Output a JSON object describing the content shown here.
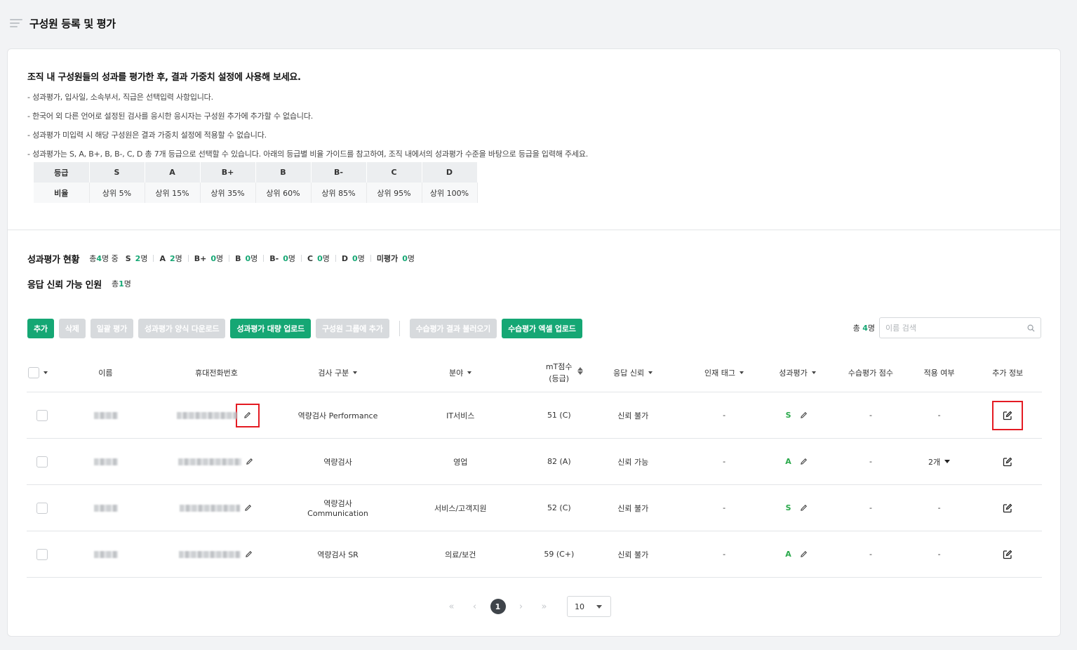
{
  "header": {
    "title": "구성원 등록 및 평가"
  },
  "info": {
    "title": "조직 내 구성원들의 성과를 평가한 후, 결과 가중치 설정에 사용해 보세요.",
    "notes": [
      "- 성과평가, 입사일, 소속부서, 직급은 선택입력 사항입니다.",
      "- 한국어 외 다른 언어로 설정된 검사를 응시한 응시자는 구성원 추가에 추가할 수 없습니다.",
      "- 성과평가 미입력 시 해당 구성원은 결과 가중치 설정에 적용할 수 없습니다.",
      "- 성과평가는 S, A, B+, B, B-, C, D 총 7개 등급으로 선택할 수 있습니다. 아래의 등급별 비율 가이드를 참고하여, 조직 내에서의 성과평가 수준을 바탕으로 등급을 입력해 주세요."
    ],
    "grade_table": {
      "head_label": "등급",
      "body_label": "비율",
      "grades": [
        "S",
        "A",
        "B+",
        "B",
        "B-",
        "C",
        "D"
      ],
      "ratios": [
        "상위 5%",
        "상위 15%",
        "상위 35%",
        "상위 60%",
        "상위 85%",
        "상위 95%",
        "상위 100%"
      ]
    }
  },
  "stats": {
    "eval_title": "성과평가 현황",
    "eval_total_prefix": "총 ",
    "eval_total_n": "4",
    "eval_total_suffix": "명 중",
    "items": [
      {
        "label": "S",
        "n": "2",
        "unit": "명"
      },
      {
        "label": "A",
        "n": "2",
        "unit": "명"
      },
      {
        "label": "B+",
        "n": "0",
        "unit": "명"
      },
      {
        "label": "B",
        "n": "0",
        "unit": "명"
      },
      {
        "label": "B-",
        "n": "0",
        "unit": "명"
      },
      {
        "label": "C",
        "n": "0",
        "unit": "명"
      },
      {
        "label": "D",
        "n": "0",
        "unit": "명"
      },
      {
        "label": "미평가",
        "n": "0",
        "unit": "명"
      }
    ],
    "reliable_title": "응답 신뢰 가능 인원",
    "reliable_prefix": "총 ",
    "reliable_n": "1",
    "reliable_unit": "명"
  },
  "toolbar": {
    "add": "추가",
    "delete": "삭제",
    "bulk_eval": "일괄 평가",
    "download_form": "성과평가 양식 다운로드",
    "bulk_upload": "성과평가 대량 업로드",
    "add_to_group": "구성원 그룹에 추가",
    "load_trial": "수습평가 결과 불러오기",
    "trial_excel_upload": "수습평가 엑셀 업로드"
  },
  "search": {
    "total_prefix": "총 ",
    "total_n": "4",
    "total_unit": "명",
    "placeholder": "이름 검색"
  },
  "table": {
    "columns": [
      "이름",
      "휴대전화번호",
      "검사 구분",
      "분야",
      "mT점수",
      "(등급)",
      "응답 신뢰",
      "인재 태그",
      "성과평가",
      "수습평가 점수",
      "적용 여부",
      "추가 정보"
    ],
    "rows": [
      {
        "test": "역량검사 Performance",
        "field": "IT서비스",
        "score": "51 (C)",
        "reliability": "신뢰 불가",
        "tag": "-",
        "grade": "S",
        "trial": "-",
        "apply": "-"
      },
      {
        "test": "역량검사",
        "field": "영업",
        "score": "82 (A)",
        "reliability": "신뢰 가능",
        "tag": "-",
        "grade": "A",
        "trial": "-",
        "apply": "2개"
      },
      {
        "test": "역량검사 Communication",
        "field": "서비스/고객지원",
        "score": "52 (C)",
        "reliability": "신뢰 불가",
        "tag": "-",
        "grade": "S",
        "trial": "-",
        "apply": "-"
      },
      {
        "test": "역량검사 SR",
        "field": "의료/보건",
        "score": "59 (C+)",
        "reliability": "신뢰 불가",
        "tag": "-",
        "grade": "A",
        "trial": "-",
        "apply": "-"
      }
    ]
  },
  "pagination": {
    "current": "1",
    "page_size": "10"
  },
  "colors": {
    "accent": "#15a774",
    "grade": "#2aa94b",
    "highlight": "#e41b23"
  },
  "icons": [
    "menu-icon",
    "search-icon",
    "pencil-icon",
    "edit-icon",
    "caret-down-icon",
    "sort-icon",
    "first-page-icon",
    "prev-page-icon",
    "next-page-icon",
    "last-page-icon"
  ]
}
